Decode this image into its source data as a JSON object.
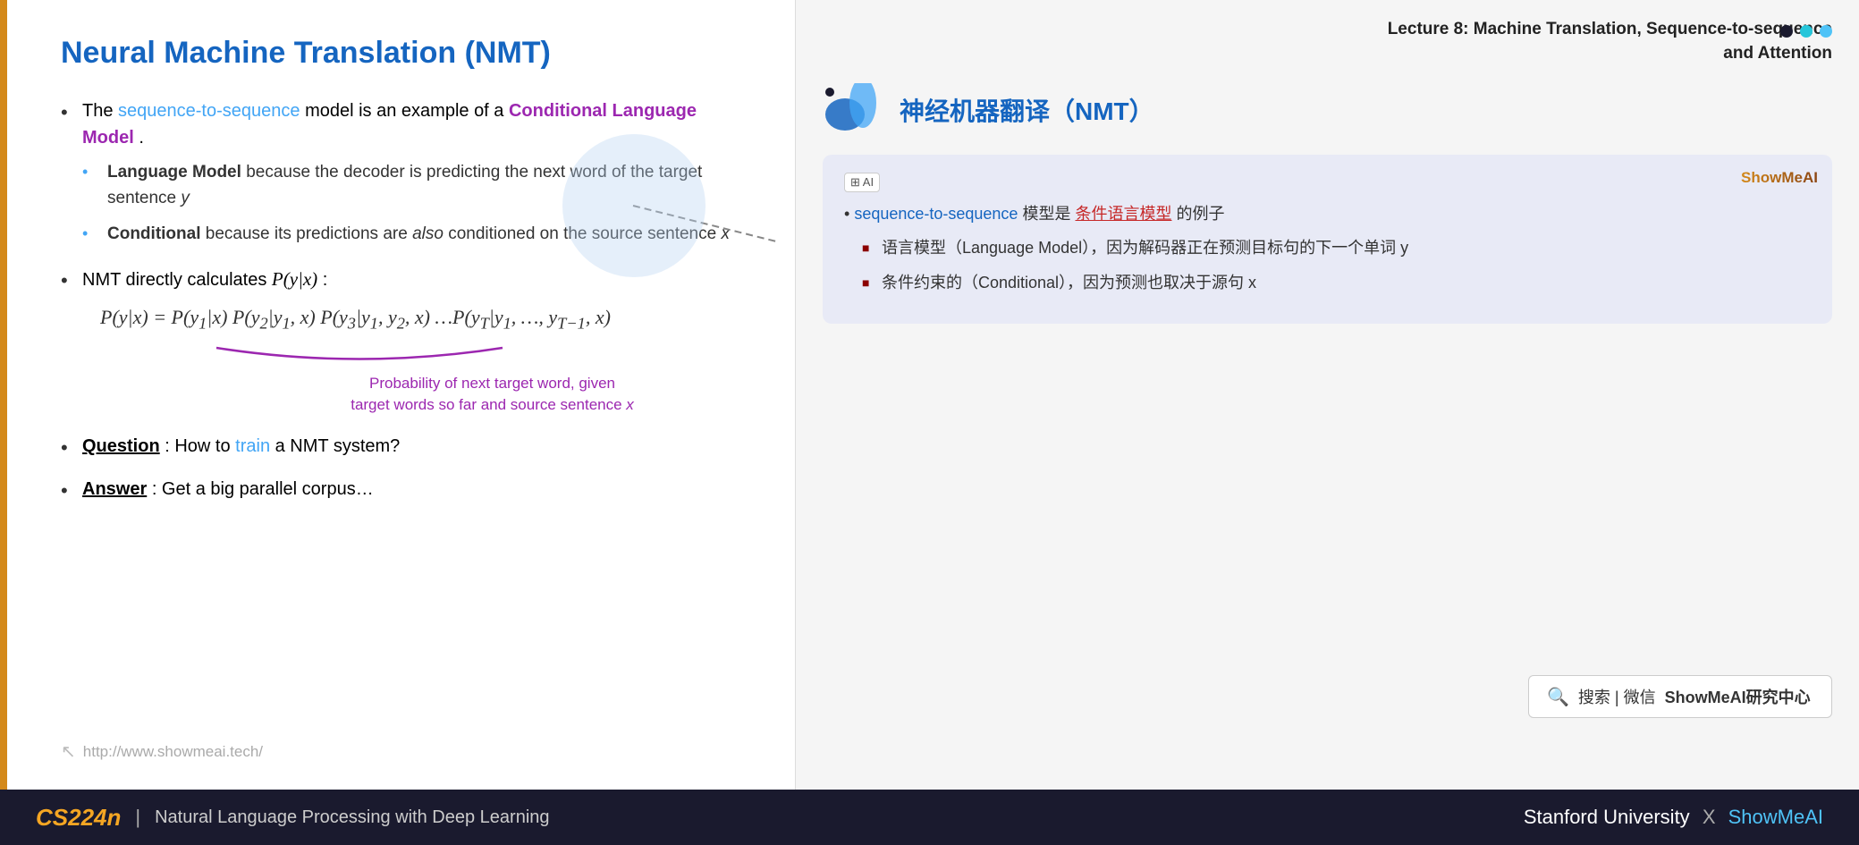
{
  "lecture": {
    "header_line1": "Lecture 8:  Machine Translation, Sequence-to-sequence",
    "header_line2": "and Attention"
  },
  "slide": {
    "title": "Neural Machine Translation (NMT)",
    "bullet1": {
      "prefix": "The ",
      "seq2seq": "sequence-to-sequence",
      "middle": " model is an example of a ",
      "cond_lang_model": "Conditional Language Model",
      "suffix": "."
    },
    "sub_bullet1": {
      "bold": "Language Model",
      "text": " because the decoder is predicting the next word of the target sentence ",
      "italic": "y"
    },
    "sub_bullet2": {
      "bold": "Conditional",
      "text1": " because its predictions are ",
      "italic": "also",
      "text2": " conditioned on the source sentence ",
      "x": "x"
    },
    "bullet2_prefix": "NMT directly calculates ",
    "formula_main": "P(y|x) = P(y₁|x) P(y₂|y₁, x) P(y₃|y₁, y₂, x) … P(yT|y₁, …, yT−1, x)",
    "annotation": "Probability of next target word, given\ntarget words so far and source sentence x",
    "question": {
      "bold": "Question",
      "text": ": How to ",
      "train": "train",
      "suffix": " a NMT system?"
    },
    "answer": {
      "bold": "Answer",
      "text": ": Get a big parallel corpus…"
    },
    "url": "http://www.showmeai.tech/"
  },
  "translation_box": {
    "ai_badge": "⊞ AI",
    "watermark": "ShowMeAI",
    "bullet_prefix": "sequence-to-sequence",
    "bullet_suffix": "模型是",
    "bullet_red": "条件语言模型",
    "bullet_end": "的例子",
    "sub1_text": "语言模型（Language Model），因为解码器正在预测目标句的下一个单词 y",
    "sub2_text": "条件约束的（Conditional），因为预测也取决于源句 x"
  },
  "nmt_section": {
    "title": "神经机器翻译（NMT）"
  },
  "search": {
    "icon": "🔍",
    "divider": "搜索 | 微信",
    "label": "ShowMeAI研究中心"
  },
  "bottom_bar": {
    "course": "CS224n",
    "divider": "|",
    "subtitle": "Natural Language Processing with Deep Learning",
    "right_text": "Stanford University",
    "x": "X",
    "showmeai": "ShowMeAI"
  },
  "dots": [
    {
      "color": "dot-dark"
    },
    {
      "color": "dot-teal"
    },
    {
      "color": "dot-cyan"
    }
  ]
}
